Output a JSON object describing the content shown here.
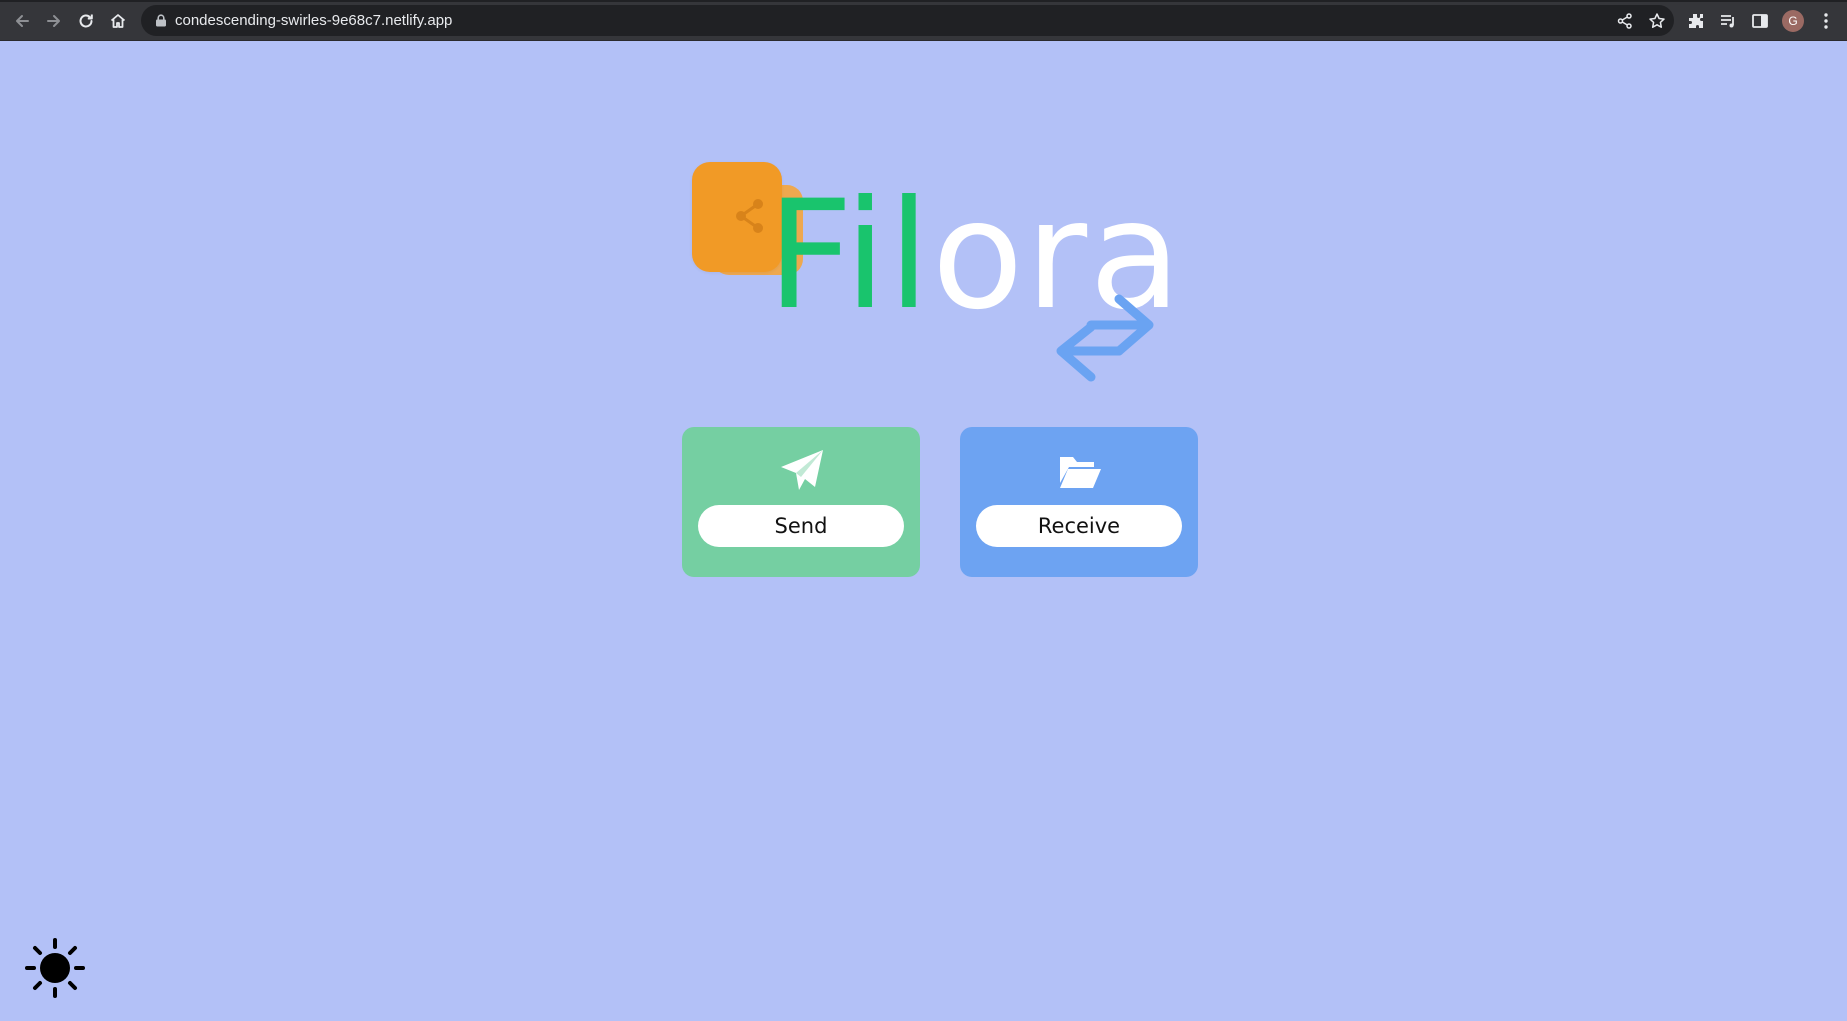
{
  "browser": {
    "url": "condescending-swirles-9e68c7.netlify.app",
    "avatar_letter": "G",
    "icons": [
      "back-icon",
      "forward-icon",
      "reload-icon",
      "home-icon",
      "lock-icon",
      "share-icon",
      "star-icon",
      "extensions-icon",
      "media-icon",
      "side-panel-icon",
      "menu-icon"
    ]
  },
  "logo": {
    "word_green": "Fil",
    "word_white": "ora",
    "icons": [
      "share-nodes-icon",
      "swap-arrows-icon"
    ],
    "colors": {
      "green": "#19c46d",
      "white": "#ffffff",
      "orange": "#f19a26",
      "blue_arrows": "#6aa3f2"
    }
  },
  "actions": {
    "send": {
      "label": "Send",
      "icon": "paper-plane-icon",
      "color": "#75cfa2"
    },
    "receive": {
      "label": "Receive",
      "icon": "folder-open-icon",
      "color": "#6da3f2"
    }
  },
  "theme_toggle": {
    "icon": "sun-icon"
  },
  "page": {
    "background": "#b3c1f7"
  }
}
